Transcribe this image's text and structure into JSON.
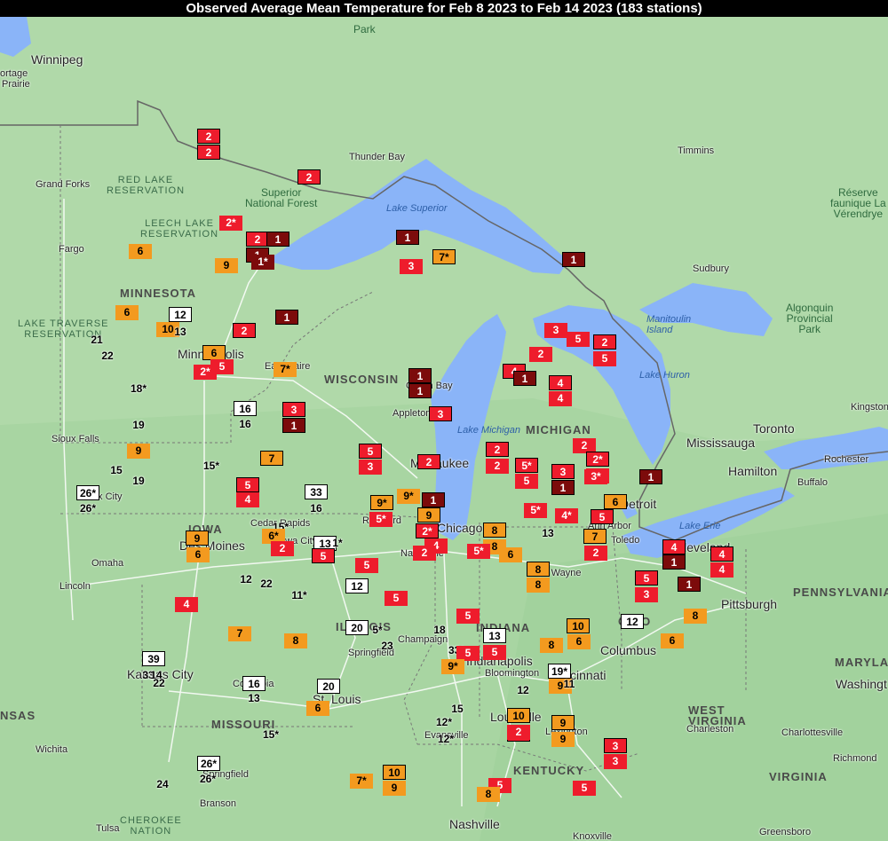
{
  "title": "Observed Average Mean Temperature for Feb 8 2023 to Feb 14 2023 (183 stations)",
  "colors": {
    "white": "#ffffff",
    "orange": "#f39a1f",
    "red": "#ee1c2c",
    "dark": "#7c0b0b",
    "land": "#a8d5a2",
    "water": "#8ab4f8"
  },
  "map_labels": [
    {
      "id": "winnipeg",
      "text": "Winnipeg",
      "cls": "city"
    },
    {
      "id": "portage",
      "text": "ortage",
      "cls": "city-sm"
    },
    {
      "id": "prairie",
      "text": "Prairie",
      "cls": "city-sm"
    },
    {
      "id": "park-top",
      "text": "Park",
      "cls": "park"
    },
    {
      "id": "thunder-bay",
      "text": "Thunder Bay",
      "cls": "city-sm"
    },
    {
      "id": "timmins",
      "text": "Timmins",
      "cls": "city-sm"
    },
    {
      "id": "grand-forks",
      "text": "Grand Forks",
      "cls": "city-sm"
    },
    {
      "id": "red-lake-res",
      "text": "RED LAKE\nRESERVATION",
      "cls": "res"
    },
    {
      "id": "superior-nf",
      "text": "Superior\nNational Forest",
      "cls": "park"
    },
    {
      "id": "lake-superior",
      "text": "Lake Superior",
      "cls": "water"
    },
    {
      "id": "reserve-faunique",
      "text": "Réserve\nfaunique La\nVérendrye",
      "cls": "park"
    },
    {
      "id": "leech-lake-res",
      "text": "LEECH LAKE\nRESERVATION",
      "cls": "res"
    },
    {
      "id": "fargo",
      "text": "Fargo",
      "cls": "city-sm"
    },
    {
      "id": "minnesota",
      "text": "MINNESOTA",
      "cls": "state"
    },
    {
      "id": "sudbury",
      "text": "Sudbury",
      "cls": "city-sm"
    },
    {
      "id": "manitoulin",
      "text": "Manitoulin\nIsland",
      "cls": "water"
    },
    {
      "id": "algonquin",
      "text": "Algonquin\nProvincial\nPark",
      "cls": "park"
    },
    {
      "id": "lake-traverse",
      "text": "LAKE TRAVERSE\nRESERVATION",
      "cls": "res"
    },
    {
      "id": "minneapolis",
      "text": "Minneapolis",
      "cls": "city"
    },
    {
      "id": "eau-claire",
      "text": "Eau Claire",
      "cls": "city-sm"
    },
    {
      "id": "wisconsin",
      "text": "WISCONSIN",
      "cls": "state"
    },
    {
      "id": "green-bay",
      "text": "Green Bay",
      "cls": "city-sm"
    },
    {
      "id": "lake-huron",
      "text": "Lake Huron",
      "cls": "water"
    },
    {
      "id": "appleton",
      "text": "Appleton",
      "cls": "city-sm"
    },
    {
      "id": "lake-michigan",
      "text": "Lake Michigan",
      "cls": "water"
    },
    {
      "id": "michigan",
      "text": "MICHIGAN",
      "cls": "state"
    },
    {
      "id": "kingston",
      "text": "Kingston",
      "cls": "city-sm"
    },
    {
      "id": "toronto",
      "text": "Toronto",
      "cls": "city"
    },
    {
      "id": "mississauga",
      "text": "Mississauga",
      "cls": "city"
    },
    {
      "id": "sioux-falls",
      "text": "Sioux Falls",
      "cls": "city-sm"
    },
    {
      "id": "hamilton",
      "text": "Hamilton",
      "cls": "city"
    },
    {
      "id": "rochester",
      "text": "Rochester",
      "cls": "city-sm"
    },
    {
      "id": "milwaukee",
      "text": "Milwaukee",
      "cls": "city"
    },
    {
      "id": "buffalo",
      "text": "Buffalo",
      "cls": "city-sm"
    },
    {
      "id": "sioux-city",
      "text": "Sioux City",
      "cls": "city-sm"
    },
    {
      "id": "rockford",
      "text": "Rockford",
      "cls": "city-sm"
    },
    {
      "id": "detroit",
      "text": "Detroit",
      "cls": "city"
    },
    {
      "id": "lake-erie",
      "text": "Lake Erie",
      "cls": "water"
    },
    {
      "id": "cedar-rapids",
      "text": "Cedar Rapids",
      "cls": "city-sm"
    },
    {
      "id": "chicago",
      "text": "Chicago",
      "cls": "city"
    },
    {
      "id": "ann-arbor",
      "text": "Ann Arbor",
      "cls": "city-sm"
    },
    {
      "id": "iowa",
      "text": "IOWA",
      "cls": "state"
    },
    {
      "id": "des-moines",
      "text": "Des Moines",
      "cls": "city"
    },
    {
      "id": "iowa-city",
      "text": "Iowa City",
      "cls": "city-sm"
    },
    {
      "id": "toledo",
      "text": "Toledo",
      "cls": "city-sm"
    },
    {
      "id": "cleveland",
      "text": "Cleveland",
      "cls": "city"
    },
    {
      "id": "naperville",
      "text": "Naperville",
      "cls": "city-sm"
    },
    {
      "id": "omaha",
      "text": "Omaha",
      "cls": "city-sm"
    },
    {
      "id": "fort-wayne",
      "text": "Fort Wayne",
      "cls": "city-sm"
    },
    {
      "id": "lincoln",
      "text": "Lincoln",
      "cls": "city-sm"
    },
    {
      "id": "pennsylvania",
      "text": "PENNSYLVANIA",
      "cls": "state"
    },
    {
      "id": "pittsburgh",
      "text": "Pittsburgh",
      "cls": "city"
    },
    {
      "id": "illinois",
      "text": "ILLINOIS",
      "cls": "state"
    },
    {
      "id": "champaign",
      "text": "Champaign",
      "cls": "city-sm"
    },
    {
      "id": "indiana",
      "text": "INDIANA",
      "cls": "state"
    },
    {
      "id": "ohio",
      "text": "OHIO",
      "cls": "state"
    },
    {
      "id": "springfield",
      "text": "Springfield",
      "cls": "city-sm"
    },
    {
      "id": "columbus",
      "text": "Columbus",
      "cls": "city"
    },
    {
      "id": "indianapolis",
      "text": "Indianapolis",
      "cls": "city"
    },
    {
      "id": "bloomington",
      "text": "Bloomington",
      "cls": "city-sm"
    },
    {
      "id": "maryland",
      "text": "MARYLA",
      "cls": "state"
    },
    {
      "id": "washington",
      "text": "Washingt",
      "cls": "city"
    },
    {
      "id": "kansas-city",
      "text": "Kansas City",
      "cls": "city"
    },
    {
      "id": "cincinnati",
      "text": "Cincinnati",
      "cls": "city"
    },
    {
      "id": "columbia",
      "text": "Columbia",
      "cls": "city-sm"
    },
    {
      "id": "st-louis",
      "text": "St. Louis",
      "cls": "city"
    },
    {
      "id": "west-virginia",
      "text": "WEST\nVIRGINIA",
      "cls": "state"
    },
    {
      "id": "kansas",
      "text": "NSAS",
      "cls": "state"
    },
    {
      "id": "missouri",
      "text": "MISSOURI",
      "cls": "state"
    },
    {
      "id": "louisville",
      "text": "Louisville",
      "cls": "city"
    },
    {
      "id": "lexington",
      "text": "Lexington",
      "cls": "city-sm"
    },
    {
      "id": "charleston",
      "text": "Charleston",
      "cls": "city-sm"
    },
    {
      "id": "charlottesville",
      "text": "Charlottesville",
      "cls": "city-sm"
    },
    {
      "id": "wichita",
      "text": "Wichita",
      "cls": "city-sm"
    },
    {
      "id": "evansville",
      "text": "Evansville",
      "cls": "city-sm"
    },
    {
      "id": "kentucky",
      "text": "KENTUCKY",
      "cls": "state"
    },
    {
      "id": "richmond",
      "text": "Richmond",
      "cls": "city-sm"
    },
    {
      "id": "springfield-mo",
      "text": "Springfield",
      "cls": "city-sm"
    },
    {
      "id": "virginia",
      "text": "VIRGINIA",
      "cls": "state"
    },
    {
      "id": "branson",
      "text": "Branson",
      "cls": "city-sm"
    },
    {
      "id": "cherokee-nation",
      "text": "CHEROKEE\nNATION",
      "cls": "res"
    },
    {
      "id": "tulsa",
      "text": "Tulsa",
      "cls": "city-sm"
    },
    {
      "id": "nashville",
      "text": "Nashville",
      "cls": "city"
    },
    {
      "id": "knoxville",
      "text": "Knoxville",
      "cls": "city-sm"
    },
    {
      "id": "greensboro",
      "text": "Greensboro",
      "cls": "city-sm"
    }
  ],
  "stations": [
    {
      "v": "2",
      "c": "red"
    },
    {
      "v": "2",
      "c": "red"
    },
    {
      "v": "2",
      "c": "red"
    },
    {
      "v": "2*",
      "c": "red"
    },
    {
      "v": "2",
      "c": "red"
    },
    {
      "v": "1",
      "c": "dark"
    },
    {
      "v": "1",
      "c": "dark"
    },
    {
      "v": "1*",
      "c": "dark"
    },
    {
      "v": "6",
      "c": "orange"
    },
    {
      "v": "9",
      "c": "orange"
    },
    {
      "v": "1",
      "c": "dark"
    },
    {
      "v": "3",
      "c": "red"
    },
    {
      "v": "7*",
      "c": "orange"
    },
    {
      "v": "1",
      "c": "dark"
    },
    {
      "v": "1",
      "c": "dark"
    },
    {
      "v": "6",
      "c": "orange"
    },
    {
      "v": "12",
      "c": "white"
    },
    {
      "v": "10",
      "c": "orange"
    },
    {
      "v": "13",
      "c": "white"
    },
    {
      "v": "21",
      "c": "white"
    },
    {
      "v": "22",
      "c": "white"
    },
    {
      "v": "1",
      "c": "dark"
    },
    {
      "v": "2",
      "c": "red"
    },
    {
      "v": "3",
      "c": "red"
    },
    {
      "v": "5",
      "c": "red"
    },
    {
      "v": "2",
      "c": "red"
    },
    {
      "v": "5",
      "c": "red"
    },
    {
      "v": "2",
      "c": "red"
    },
    {
      "v": "6",
      "c": "orange"
    },
    {
      "v": "5",
      "c": "red"
    },
    {
      "v": "2*",
      "c": "red"
    },
    {
      "v": "7*",
      "c": "orange"
    },
    {
      "v": "4",
      "c": "red"
    },
    {
      "v": "1",
      "c": "dark"
    },
    {
      "v": "1",
      "c": "dark"
    },
    {
      "v": "1",
      "c": "dark"
    },
    {
      "v": "4",
      "c": "red"
    },
    {
      "v": "4",
      "c": "red"
    },
    {
      "v": "18*",
      "c": "white"
    },
    {
      "v": "16",
      "c": "white"
    },
    {
      "v": "16",
      "c": "white"
    },
    {
      "v": "3",
      "c": "red"
    },
    {
      "v": "1",
      "c": "dark"
    },
    {
      "v": "3",
      "c": "red"
    },
    {
      "v": "19",
      "c": "white"
    },
    {
      "v": "2",
      "c": "red"
    },
    {
      "v": "9",
      "c": "orange"
    },
    {
      "v": "7",
      "c": "orange"
    },
    {
      "v": "5",
      "c": "red"
    },
    {
      "v": "3",
      "c": "red"
    },
    {
      "v": "2",
      "c": "red"
    },
    {
      "v": "2",
      "c": "red"
    },
    {
      "v": "1",
      "c": "dark"
    },
    {
      "v": "2",
      "c": "red"
    },
    {
      "v": "5*",
      "c": "red"
    },
    {
      "v": "2*",
      "c": "red"
    },
    {
      "v": "3",
      "c": "red"
    },
    {
      "v": "15",
      "c": "white"
    },
    {
      "v": "15*",
      "c": "white"
    },
    {
      "v": "19",
      "c": "white"
    },
    {
      "v": "5",
      "c": "red"
    },
    {
      "v": "3",
      "c": "red"
    },
    {
      "v": "5",
      "c": "red"
    },
    {
      "v": "3*",
      "c": "red"
    },
    {
      "v": "1",
      "c": "dark"
    },
    {
      "v": "1",
      "c": "dark"
    },
    {
      "v": "26*",
      "c": "white"
    },
    {
      "v": "5",
      "c": "red"
    },
    {
      "v": "33",
      "c": "white"
    },
    {
      "v": "9*",
      "c": "orange"
    },
    {
      "v": "9*",
      "c": "orange"
    },
    {
      "v": "1",
      "c": "dark"
    },
    {
      "v": "6",
      "c": "orange"
    },
    {
      "v": "26*",
      "c": "white"
    },
    {
      "v": "4",
      "c": "red"
    },
    {
      "v": "16",
      "c": "white"
    },
    {
      "v": "5*",
      "c": "red"
    },
    {
      "v": "9",
      "c": "orange"
    },
    {
      "v": "5*",
      "c": "red"
    },
    {
      "v": "4*",
      "c": "red"
    },
    {
      "v": "5",
      "c": "red"
    },
    {
      "v": "7",
      "c": "orange"
    },
    {
      "v": "15*",
      "c": "white"
    },
    {
      "v": "6*",
      "c": "orange"
    },
    {
      "v": "2*",
      "c": "red"
    },
    {
      "v": "8",
      "c": "orange"
    },
    {
      "v": "13",
      "c": "white"
    },
    {
      "v": "9",
      "c": "orange"
    },
    {
      "v": "13",
      "c": "white"
    },
    {
      "v": "1*",
      "c": "white"
    },
    {
      "v": "4",
      "c": "red"
    },
    {
      "v": "2",
      "c": "red"
    },
    {
      "v": "8",
      "c": "orange"
    },
    {
      "v": "5*",
      "c": "red"
    },
    {
      "v": "6",
      "c": "orange"
    },
    {
      "v": "2",
      "c": "red"
    },
    {
      "v": "5",
      "c": "red"
    },
    {
      "v": "4",
      "c": "red"
    },
    {
      "v": "6",
      "c": "orange"
    },
    {
      "v": "2",
      "c": "red"
    },
    {
      "v": "4",
      "c": "red"
    },
    {
      "v": "1",
      "c": "dark"
    },
    {
      "v": "4",
      "c": "red"
    },
    {
      "v": "4",
      "c": "red"
    },
    {
      "v": "1",
      "c": "dark"
    },
    {
      "v": "12",
      "c": "white"
    },
    {
      "v": "22",
      "c": "white"
    },
    {
      "v": "12",
      "c": "white"
    },
    {
      "v": "8",
      "c": "orange"
    },
    {
      "v": "8",
      "c": "orange"
    },
    {
      "v": "5",
      "c": "red"
    },
    {
      "v": "5",
      "c": "red"
    },
    {
      "v": "3",
      "c": "red"
    },
    {
      "v": "11*",
      "c": "white"
    },
    {
      "v": "5",
      "c": "red"
    },
    {
      "v": "4",
      "c": "red"
    },
    {
      "v": "8",
      "c": "orange"
    },
    {
      "v": "7",
      "c": "orange"
    },
    {
      "v": "8",
      "c": "orange"
    },
    {
      "v": "20",
      "c": "white"
    },
    {
      "v": "5*",
      "c": "white"
    },
    {
      "v": "18",
      "c": "white"
    },
    {
      "v": "5",
      "c": "red"
    },
    {
      "v": "10",
      "c": "orange"
    },
    {
      "v": "12",
      "c": "white"
    },
    {
      "v": "23",
      "c": "white"
    },
    {
      "v": "13",
      "c": "white"
    },
    {
      "v": "8",
      "c": "orange"
    },
    {
      "v": "6",
      "c": "orange"
    },
    {
      "v": "5",
      "c": "red"
    },
    {
      "v": "6",
      "c": "orange"
    },
    {
      "v": "33*",
      "c": "white"
    },
    {
      "v": "5",
      "c": "red"
    },
    {
      "v": "39",
      "c": "white"
    },
    {
      "v": "33",
      "c": "white"
    },
    {
      "v": "9*",
      "c": "orange"
    },
    {
      "v": "19*",
      "c": "white"
    },
    {
      "v": "14",
      "c": "white"
    },
    {
      "v": "22",
      "c": "white"
    },
    {
      "v": "16",
      "c": "white"
    },
    {
      "v": "20",
      "c": "white"
    },
    {
      "v": "12",
      "c": "white"
    },
    {
      "v": "9",
      "c": "orange"
    },
    {
      "v": "11",
      "c": "white"
    },
    {
      "v": "13",
      "c": "white"
    },
    {
      "v": "6",
      "c": "orange"
    },
    {
      "v": "15",
      "c": "white"
    },
    {
      "v": "10",
      "c": "orange"
    },
    {
      "v": "9",
      "c": "orange"
    },
    {
      "v": "12*",
      "c": "white"
    },
    {
      "v": "2",
      "c": "red"
    },
    {
      "v": "15*",
      "c": "white"
    },
    {
      "v": "12*",
      "c": "white"
    },
    {
      "v": "2",
      "c": "red"
    },
    {
      "v": "9",
      "c": "orange"
    },
    {
      "v": "3",
      "c": "red"
    },
    {
      "v": "26*",
      "c": "white"
    },
    {
      "v": "3",
      "c": "red"
    },
    {
      "v": "26*",
      "c": "white"
    },
    {
      "v": "24",
      "c": "white"
    },
    {
      "v": "7*",
      "c": "orange"
    },
    {
      "v": "10",
      "c": "orange"
    },
    {
      "v": "9",
      "c": "orange"
    },
    {
      "v": "5",
      "c": "red"
    },
    {
      "v": "5",
      "c": "red"
    },
    {
      "v": "8",
      "c": "orange"
    }
  ]
}
